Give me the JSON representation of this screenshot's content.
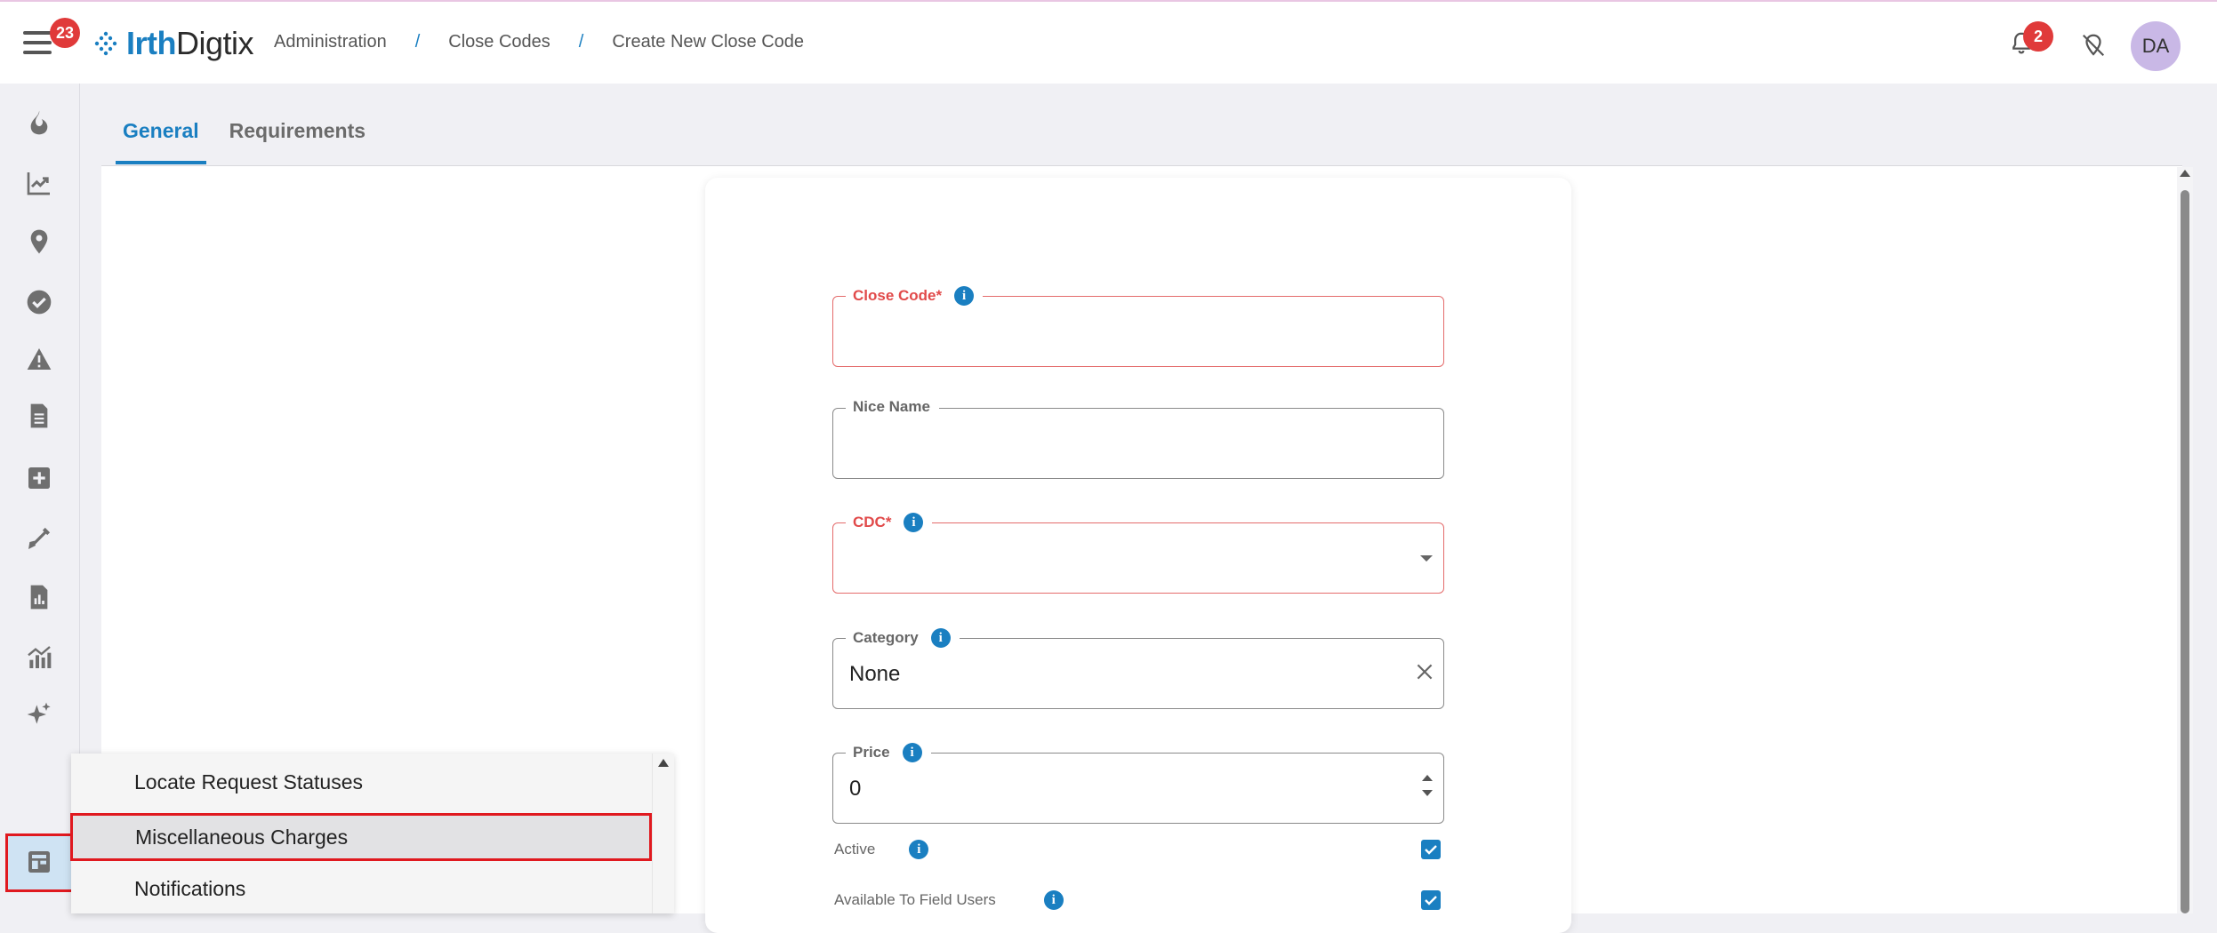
{
  "header": {
    "menu_badge": "23",
    "logo": {
      "brand_bold": "Irth",
      "brand_rest": "Digtix"
    },
    "breadcrumb": [
      "Administration",
      "Close Codes",
      "Create New Close Code"
    ],
    "breadcrumb_separator": "/",
    "notification_badge": "2",
    "avatar_initials": "DA"
  },
  "sidebar": {
    "icons": [
      "flame-icon",
      "trend-chart-icon",
      "map-pin-icon",
      "check-circle-icon",
      "warning-icon",
      "document-icon",
      "plus-box-icon",
      "shovel-icon",
      "report-icon",
      "analytics-icon",
      "sparkle-icon",
      "admin-layout-icon"
    ],
    "selected": "admin-layout-icon"
  },
  "tabs": [
    {
      "label": "General",
      "active": true
    },
    {
      "label": "Requirements",
      "active": false
    }
  ],
  "form": {
    "close_code": {
      "label": "Close Code*",
      "value": ""
    },
    "nice_name": {
      "label": "Nice Name",
      "value": ""
    },
    "cdc": {
      "label": "CDC*",
      "value": ""
    },
    "category": {
      "label": "Category",
      "value": "None"
    },
    "price": {
      "label": "Price",
      "value": "0"
    },
    "active": {
      "label": "Active",
      "checked": true
    },
    "available_to_field_users": {
      "label": "Available To Field Users",
      "checked": true
    }
  },
  "dropdown_menu": {
    "items": [
      "Locate Request Statuses",
      "Miscellaneous Charges",
      "Notifications"
    ],
    "highlighted": "Miscellaneous Charges"
  },
  "colors": {
    "accent": "#1a7fc1",
    "error": "#e14a4a",
    "badge": "#e03a3a",
    "avatar": "#c9b8e6"
  }
}
